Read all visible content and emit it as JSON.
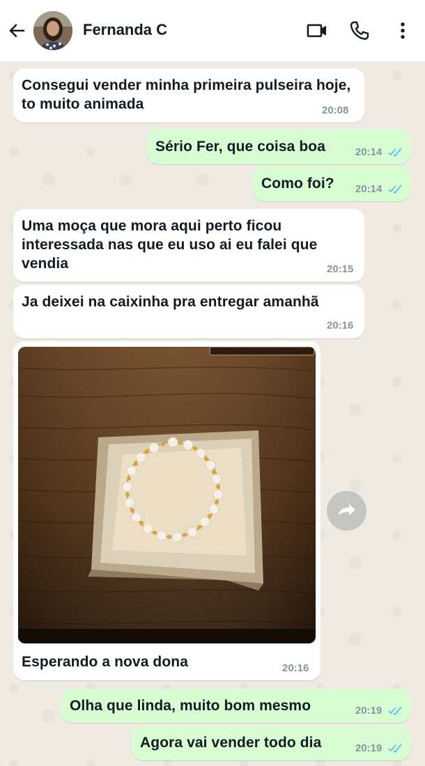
{
  "header": {
    "contact_name": "Fernanda C"
  },
  "messages": [
    {
      "text": "Consegui vender minha primeira pulseira hoje, to muito animada",
      "time": "20:08"
    },
    {
      "text": "Sério Fer, que coisa boa",
      "time": "20:14"
    },
    {
      "text": "Como foi?",
      "time": "20:14"
    },
    {
      "text": "Uma moça que mora aqui perto ficou interessada nas que eu uso ai eu falei que vendia",
      "time": "20:15"
    },
    {
      "text": "Ja deixei na caixinha pra entregar amanhã",
      "time": "20:16"
    },
    {
      "text": "Esperando a nova dona",
      "time": "20:16"
    },
    {
      "text": "Olha que linda, muito bom mesmo",
      "time": "20:19"
    },
    {
      "text": "Agora vai vender todo dia",
      "time": "20:19"
    }
  ],
  "colors": {
    "incoming_bubble": "#ffffff",
    "outgoing_bubble": "#d9fdd3",
    "read_ticks": "#53bdeb",
    "chat_background": "#efeae2"
  },
  "icons": [
    "back-arrow-icon",
    "video-call-icon",
    "phone-icon",
    "more-options-icon",
    "read-ticks-icon",
    "forward-icon"
  ]
}
